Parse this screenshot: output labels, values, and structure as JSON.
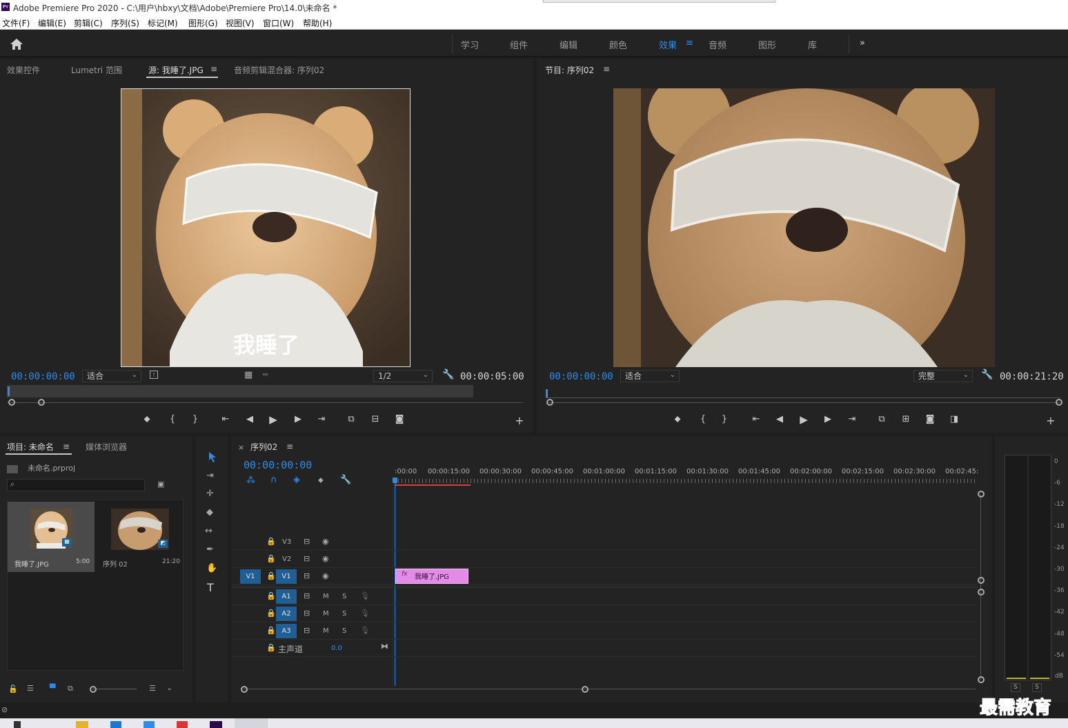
{
  "app": {
    "title": "Adobe Premiere Pro 2020 - C:\\用户\\hbxy\\文档\\Adobe\\Premiere Pro\\14.0\\未命名 *",
    "logo_text": "Pr"
  },
  "menu": [
    "文件(F)",
    "编辑(E)",
    "剪辑(C)",
    "序列(S)",
    "标记(M)",
    "图形(G)",
    "视图(V)",
    "窗口(W)",
    "帮助(H)"
  ],
  "workspaces": {
    "items": [
      "学习",
      "组件",
      "编辑",
      "颜色",
      "效果",
      "音频",
      "图形",
      "库"
    ],
    "active": "效果",
    "more": "»"
  },
  "source_panel": {
    "tabs": [
      "效果控件",
      "Lumetri 范围",
      "源: 我睡了.JPG",
      "音频剪辑混合器: 序列02"
    ],
    "active_tab": "源: 我睡了.JPG",
    "caption_in_image": "我睡了",
    "timecode_in": "00:00:00:00",
    "fit": "适合",
    "resolution": "1/2",
    "duration": "00:00:05:00"
  },
  "program_panel": {
    "tab": "节目: 序列02",
    "timecode_in": "00:00:00:00",
    "fit": "适合",
    "quality": "完整",
    "duration": "00:00:21:20"
  },
  "project_panel": {
    "tabs": [
      "项目: 未命名",
      "媒体浏览器"
    ],
    "active_tab": "项目: 未命名",
    "project_file": "未命名.prproj",
    "search_placeholder": "",
    "items": [
      {
        "name": "我睡了.JPG",
        "duration": "5:00"
      },
      {
        "name": "序列 02",
        "duration": "21:20"
      }
    ]
  },
  "timeline": {
    "tab": "序列02",
    "timecode": "00:00:00:00",
    "ruler_labels": [
      ":00:00",
      "00:00:15:00",
      "00:00:30:00",
      "00:00:45:00",
      "00:01:00:00",
      "00:01:15:00",
      "00:01:30:00",
      "00:01:45:00",
      "00:02:00:00",
      "00:02:15:00",
      "00:02:30:00",
      "00:02:45:"
    ],
    "video_tracks": [
      "V3",
      "V2",
      "V1"
    ],
    "source_patch": "V1",
    "audio_tracks": [
      "A1",
      "A2",
      "A3"
    ],
    "mute_label": "M",
    "solo_label": "S",
    "master_label": "主声道",
    "master_value": "0.0",
    "clip": {
      "name": "我睡了.JPG",
      "fx": "fx",
      "color": "#e38be6"
    }
  },
  "audio_meter": {
    "scale": [
      "0",
      "-6",
      "-12",
      "-18",
      "-24",
      "-30",
      "-36",
      "-42",
      "-48",
      "-54",
      "dB"
    ],
    "solo_buttons": [
      "S",
      "S"
    ]
  },
  "watermark": "最需教育",
  "colors": {
    "accent": "#2d8ceb",
    "panel": "#232323",
    "background": "#1e1e1e",
    "clip": "#e38be6",
    "playhead": "#2d8ceb",
    "work_area": "#e03c3c"
  }
}
